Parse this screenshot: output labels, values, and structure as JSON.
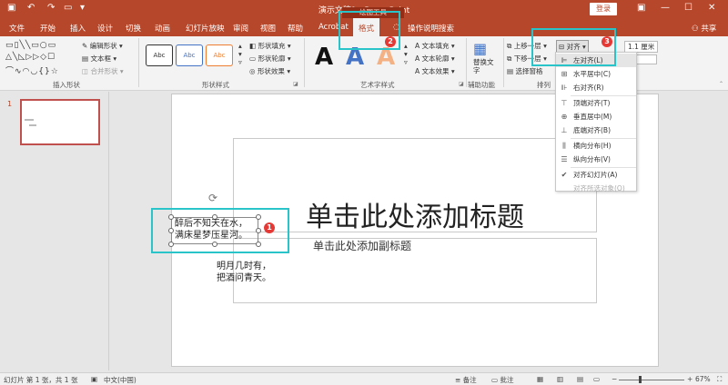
{
  "window": {
    "title": "演示文稿1 - PowerPoint",
    "drawing_tools": "绘图工具",
    "login": "登录"
  },
  "tabs": [
    "文件",
    "开始",
    "插入",
    "设计",
    "切换",
    "动画",
    "幻灯片放映",
    "审阅",
    "视图",
    "帮助",
    "Acrobat",
    "格式",
    "操作说明搜索"
  ],
  "active_tab": "格式",
  "share": "共享",
  "ribbon": {
    "insert_shapes": {
      "label": "插入形状",
      "edit_shape": "编辑形状",
      "text_box": "文本框",
      "merge_shapes": "合并形状"
    },
    "shape_styles": {
      "label": "形状样式",
      "abc": "Abc",
      "fill": "形状填充",
      "outline": "形状轮廓",
      "effects": "形状效果"
    },
    "wordart": {
      "label": "艺术字样式",
      "glyph": "A",
      "text_fill": "文本填充",
      "text_outline": "文本轮廓",
      "text_effects": "文本效果"
    },
    "accessibility": {
      "label": "辅助功能",
      "alt_text": "替换文字"
    },
    "arrange": {
      "label": "排列",
      "bring_forward": "上移一层",
      "send_backward": "下移一层",
      "selection_pane": "选择窗格",
      "align": "对齐"
    },
    "size": {
      "height": "1.1 厘米"
    }
  },
  "align_menu": [
    {
      "label": "左对齐(L)",
      "icon": "align-left-icon"
    },
    {
      "label": "水平居中(C)",
      "icon": "align-center-icon"
    },
    {
      "label": "右对齐(R)",
      "icon": "align-right-icon"
    },
    {
      "label": "顶端对齐(T)",
      "icon": "align-top-icon"
    },
    {
      "label": "垂直居中(M)",
      "icon": "align-middle-icon"
    },
    {
      "label": "底端对齐(B)",
      "icon": "align-bottom-icon"
    },
    {
      "label": "横向分布(H)",
      "icon": "distribute-horizontal-icon"
    },
    {
      "label": "纵向分布(V)",
      "icon": "distribute-vertical-icon"
    },
    {
      "label": "对齐幻灯片(A)",
      "icon": "check-icon"
    },
    {
      "label": "对齐所选对象(O)",
      "icon": ""
    }
  ],
  "slide": {
    "number": "1",
    "title_placeholder": "单击此处添加标题",
    "subtitle_placeholder": "单击此处添加副标题",
    "poem_selected": [
      "醉后不知天在水，",
      "满床星梦压星河。"
    ],
    "poem_other": [
      "明月几时有，",
      "把酒问青天。"
    ]
  },
  "badges": [
    "1",
    "2",
    "3"
  ],
  "status": {
    "slide_info": "幻灯片 第 1 张，共 1 张",
    "language": "中文(中国)",
    "notes": "备注",
    "comments": "批注",
    "zoom": "67%",
    "zoom_level": 0.67
  },
  "colors": {
    "accent": "#b7472a",
    "highlight": "#28c4c9",
    "badge": "#e53935"
  }
}
